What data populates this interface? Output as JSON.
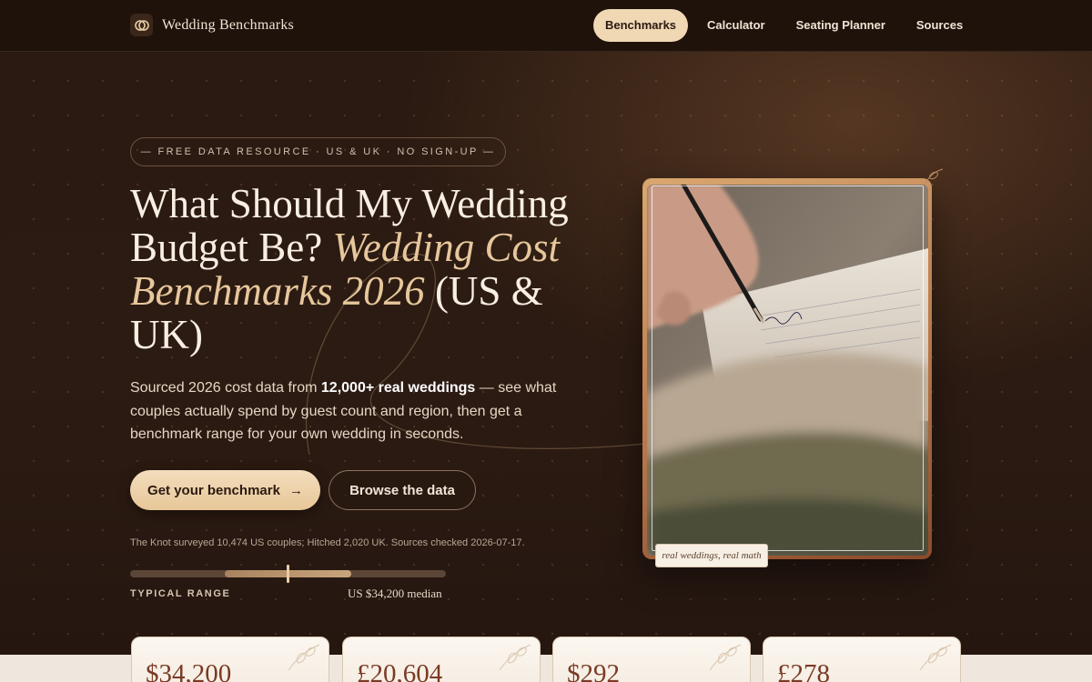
{
  "header": {
    "brand_name": "Wedding Benchmarks",
    "nav": [
      {
        "label": "Benchmarks",
        "active": true
      },
      {
        "label": "Calculator",
        "active": false
      },
      {
        "label": "Seating Planner",
        "active": false
      },
      {
        "label": "Sources",
        "active": false
      }
    ]
  },
  "hero": {
    "tagline": "— FREE DATA RESOURCE · US & UK · NO SIGN-UP —",
    "headline": {
      "part1": "What Should My Wedding Budget Be? ",
      "accent": "Wedding Cost Benchmarks 2026",
      "part2": " (US & UK)"
    },
    "lede": {
      "before": "Sourced 2026 cost data from ",
      "bold": "12,000+ real weddings",
      "after": " — see what couples actually spend by guest count and region, then get a benchmark range for your own wedding in seconds."
    },
    "primary_button": "Get your benchmark",
    "primary_button_arrow": "→",
    "secondary_button": "Browse the data",
    "source_note": "The Knot surveyed 10,474 US couples; Hitched 2,020 UK. Sources checked 2026-07-17.",
    "range": {
      "label": "TYPICAL RANGE",
      "median_text": "US $34,200 median",
      "fill_start": 0.3,
      "fill_end": 0.7,
      "marker": 0.5
    },
    "photo_caption": "real weddings, real math"
  },
  "stats": [
    {
      "value": "$34,200"
    },
    {
      "value": "£20,604"
    },
    {
      "value": "$292"
    },
    {
      "value": "£278"
    }
  ],
  "colors": {
    "background": "#2a1a11",
    "accent_gold": "#e6c79c",
    "primary_button": "#f0d8b4",
    "stat_value": "#7a3a24"
  }
}
